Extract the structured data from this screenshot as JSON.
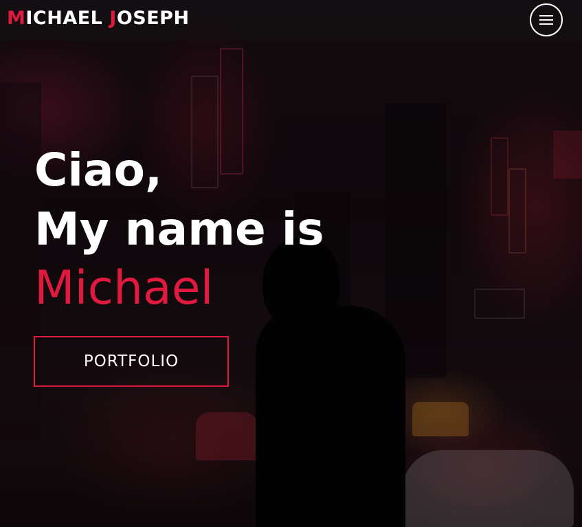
{
  "header": {
    "logo_first_initial": "M",
    "logo_first_rest": "ICHAEL ",
    "logo_last_initial": "J",
    "logo_last_rest": "OSEPH",
    "menu_icon": "hamburger-menu-icon"
  },
  "hero": {
    "greeting": "Ciao,",
    "intro": "My name is",
    "name": "Michael",
    "cta_label": "PORTFOLIO"
  },
  "colors": {
    "accent": "#e0193f",
    "text": "#ffffff",
    "header_bg": "#141214"
  }
}
